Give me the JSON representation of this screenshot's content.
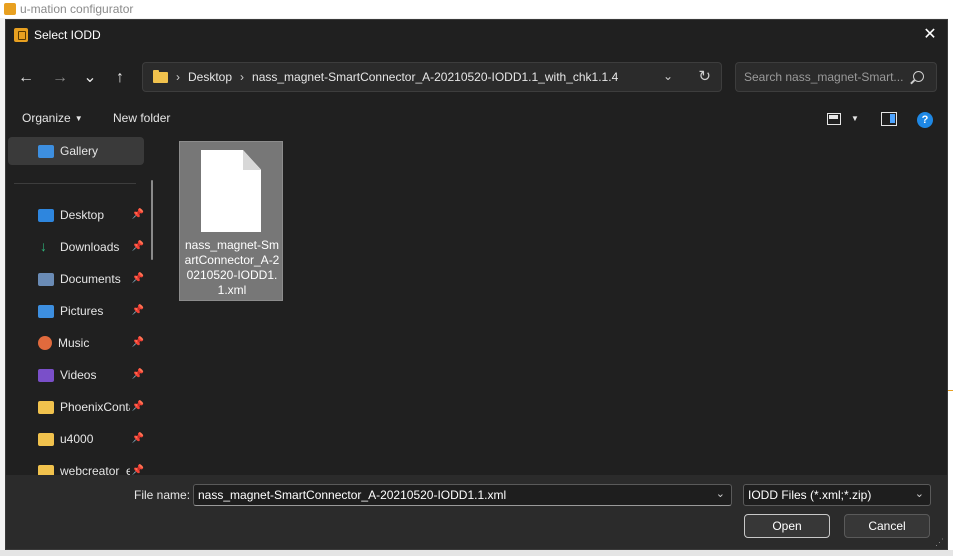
{
  "background_app": {
    "title": "u-mation configurator"
  },
  "dialog": {
    "title": "Select IODD",
    "close_glyph": "✕"
  },
  "nav": {
    "back": "←",
    "forward": "→",
    "recent": "⌄",
    "up": "↑",
    "breadcrumb": [
      "Desktop",
      "nass_magnet-SmartConnector_A-20210520-IODD1.1_with_chk1.1.4"
    ],
    "crumb_sep": "›",
    "dropdown_glyph": "⌄",
    "refresh_glyph": "↻",
    "search_placeholder": "Search nass_magnet-Smart..."
  },
  "toolbar": {
    "organize": "Organize",
    "new_folder": "New folder",
    "help_glyph": "?",
    "caret": "▼"
  },
  "sidebar": {
    "pin_glyph": "📌",
    "items": [
      {
        "label": "Gallery",
        "icon": "gallery-icon",
        "pinned": false
      },
      {
        "label": "Desktop",
        "icon": "desktop-icon",
        "pinned": true
      },
      {
        "label": "Downloads",
        "icon": "downloads-icon",
        "pinned": true
      },
      {
        "label": "Documents",
        "icon": "documents-icon",
        "pinned": true
      },
      {
        "label": "Pictures",
        "icon": "pictures-icon",
        "pinned": true
      },
      {
        "label": "Music",
        "icon": "music-icon",
        "pinned": true
      },
      {
        "label": "Videos",
        "icon": "videos-icon",
        "pinned": true
      },
      {
        "label": "PhoenixContact",
        "icon": "folder-icon",
        "pinned": true
      },
      {
        "label": "u4000",
        "icon": "folder-icon",
        "pinned": true
      },
      {
        "label": "webcreator_e",
        "icon": "folder-icon",
        "pinned": true
      }
    ]
  },
  "files": [
    {
      "name": "nass_magnet-SmartConnector_A-20210520-IODD1.1.xml",
      "selected": true
    }
  ],
  "footer": {
    "file_name_label": "File name:",
    "file_name_value": "nass_magnet-SmartConnector_A-20210520-IODD1.1.xml",
    "file_type_value": "IODD Files (*.xml;*.zip)",
    "caret": "⌄",
    "open": "Open",
    "cancel": "Cancel"
  },
  "colors": {
    "dialog_bg": "#202020",
    "footer_bg": "#2b2b2b",
    "accent_orange": "#e8a020",
    "accent_blue": "#1e88e5"
  }
}
